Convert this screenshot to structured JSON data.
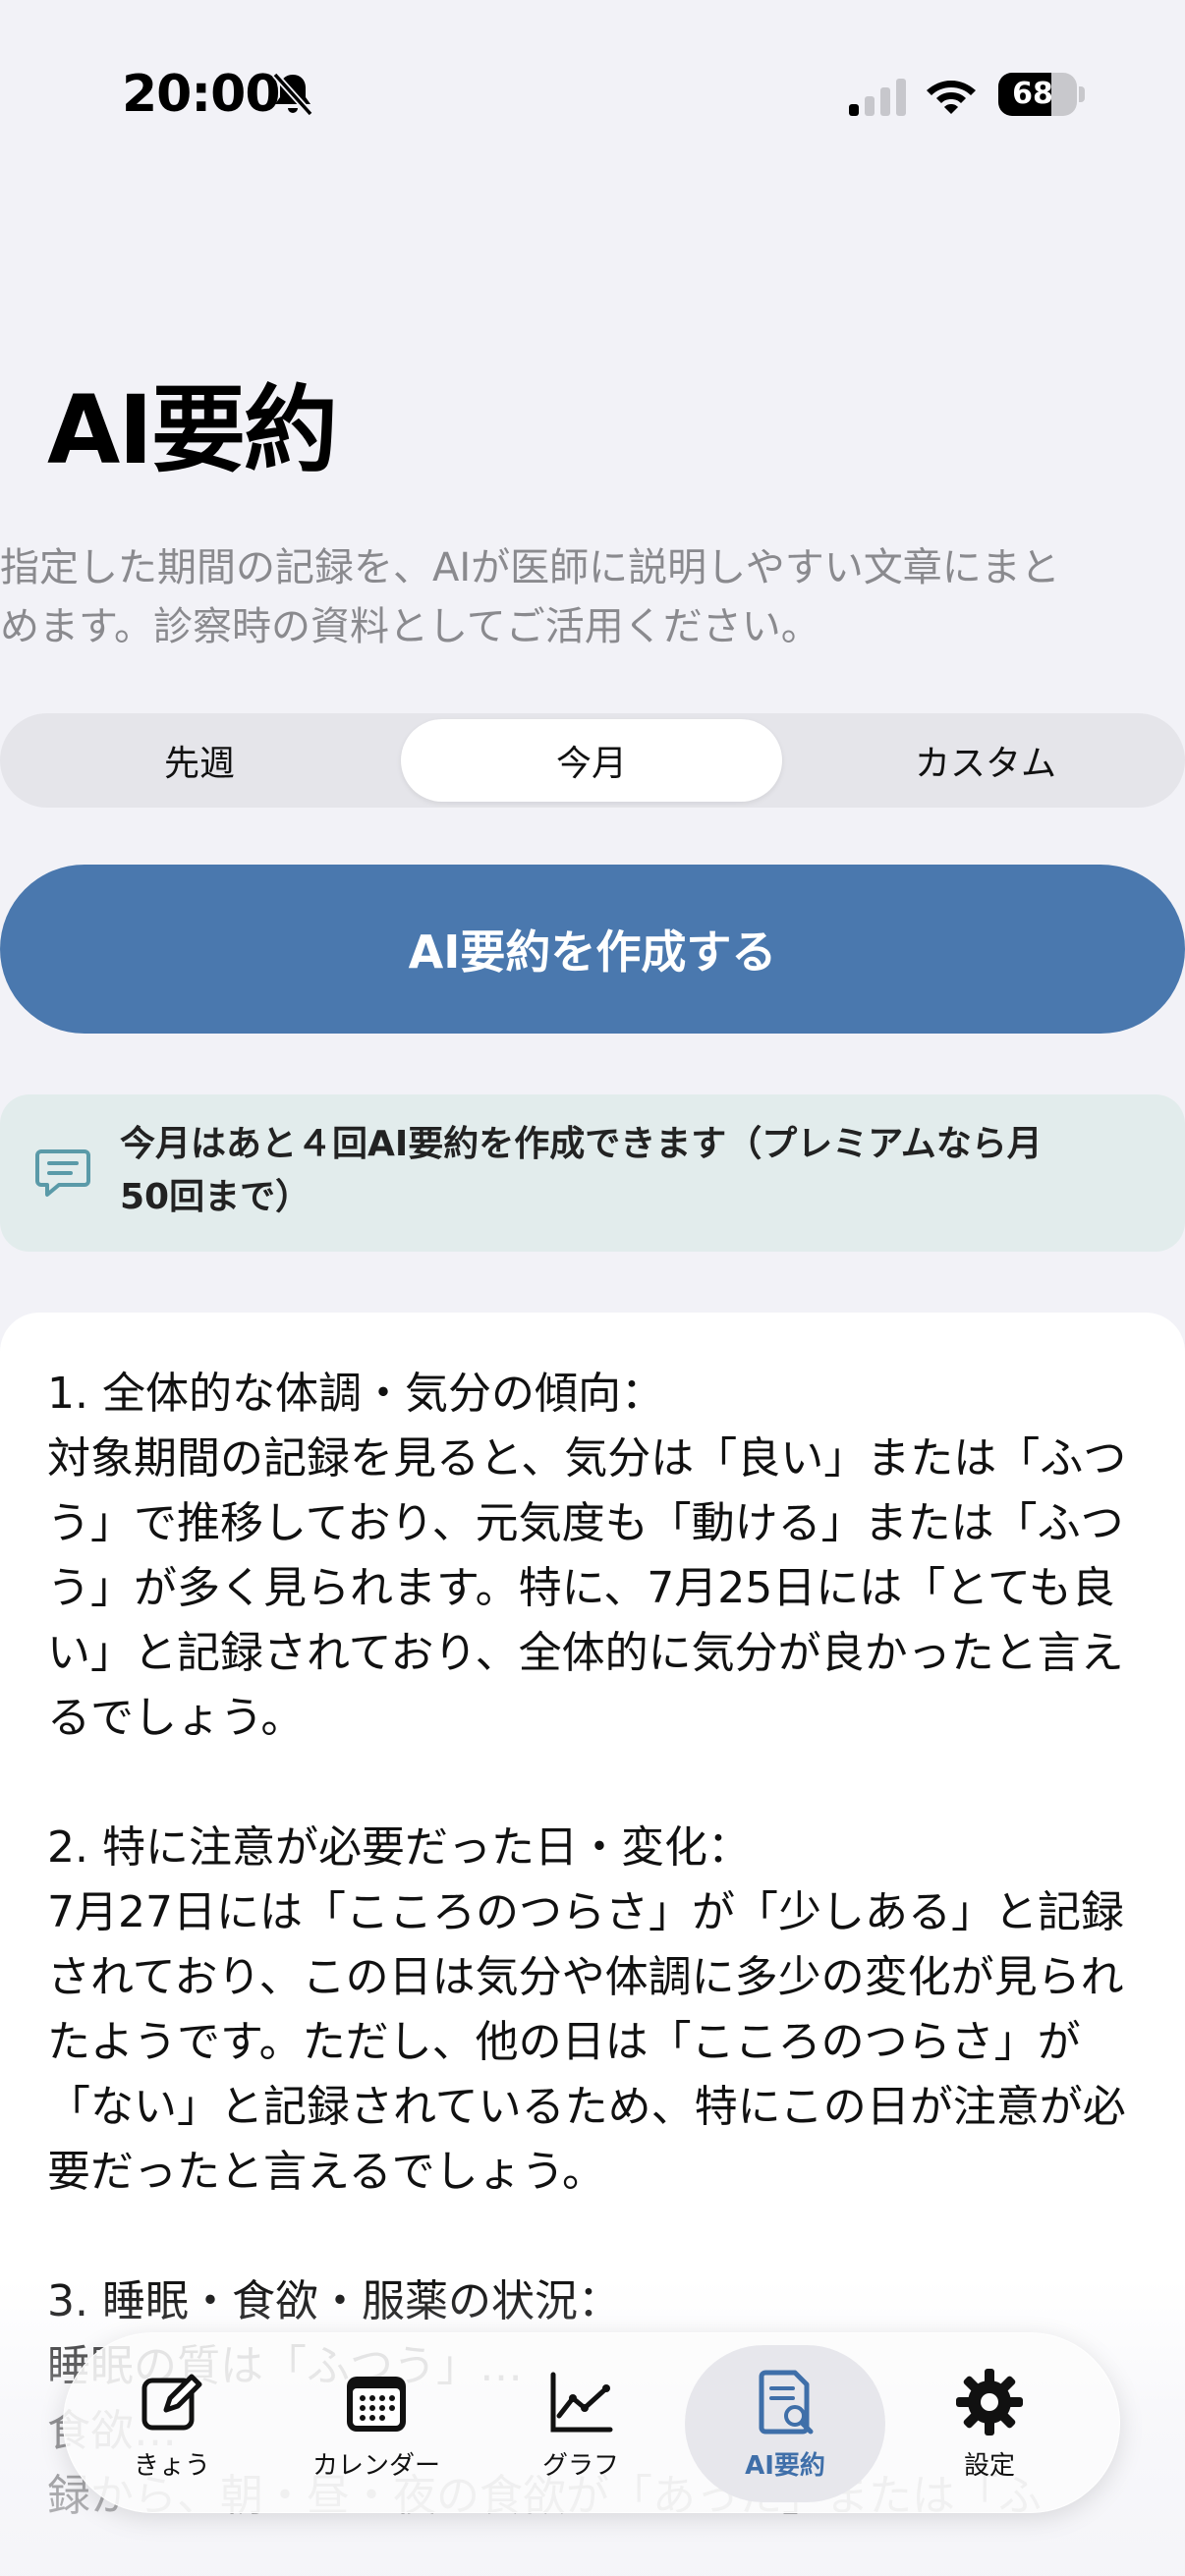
{
  "status_bar": {
    "time": "20:00",
    "battery_level": "68",
    "battery_fraction": 0.68,
    "icons": [
      "bell-slash-icon",
      "signal-icon",
      "wifi-icon",
      "battery-icon"
    ]
  },
  "page": {
    "title": "AI要約",
    "description": "指定した期間の記録を、AIが医師に説明しやすい文章にまとめます。診察時の資料としてご活用ください。"
  },
  "period_selector": {
    "options": [
      "先週",
      "今月",
      "カスタム"
    ],
    "selected": "今月"
  },
  "create_button": {
    "label": "AI要約を作成する"
  },
  "info_banner": {
    "icon": "chat-bubble-icon",
    "text": "今月はあと４回AI要約を作成できます（プレミアムなら月50回まで）"
  },
  "summary": {
    "text": "1. 全体的な体調・気分の傾向：\n対象期間の記録を見ると、気分は「良い」または「ふつう」で推移しており、元気度も「動ける」または「ふつう」が多く見られます。特に、7月25日には「とても良い」と記録されており、全体的に気分が良かったと言えるでしょう。\n\n2. 特に注意が必要だった日・変化：\n7月27日には「こころのつらさ」が「少しある」と記録されており、この日は気分や体調に多少の変化が見られたようです。ただし、他の日は「こころのつらさ」が「ない」と記録されているため、特にこの日が注意が必要だったと言えるでしょう。\n\n3. 睡眠・食欲・服薬の状況：\n睡眠の質は「ふつう」…\n食欲…\n録から、朝・昼・夜の食欲が「あった」または「ふ"
  },
  "tab_bar": {
    "accent_color": "#3f6fa9",
    "tabs": [
      {
        "label": "きょう",
        "icon": "compose-icon",
        "active": false
      },
      {
        "label": "カレンダー",
        "icon": "calendar-icon",
        "active": false
      },
      {
        "label": "グラフ",
        "icon": "line-chart-icon",
        "active": false
      },
      {
        "label": "AI要約",
        "icon": "document-search-icon",
        "active": true
      },
      {
        "label": "設定",
        "icon": "gear-icon",
        "active": false
      }
    ]
  }
}
